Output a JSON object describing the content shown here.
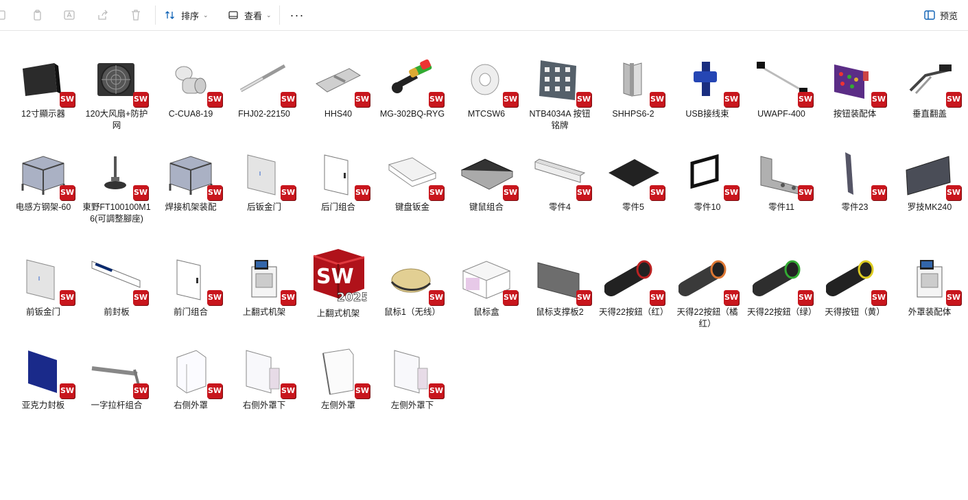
{
  "toolbar": {
    "sort_label": "排序",
    "view_label": "查看",
    "more_label": "···",
    "preview_label": "预览"
  },
  "badge_text": "SW",
  "big_badge": {
    "line1": "SW",
    "line2": "2025"
  },
  "files": [
    {
      "label": "12寸顯示器",
      "icon": "monitor"
    },
    {
      "label": "120大风扇+防护网",
      "icon": "fan"
    },
    {
      "label": "C-CUA8-19",
      "icon": "coupling"
    },
    {
      "label": "FHJ02-22150",
      "icon": "gas-spring"
    },
    {
      "label": "HHS40",
      "icon": "hinge-flat"
    },
    {
      "label": "MG-302BQ-RYG",
      "icon": "tower-light"
    },
    {
      "label": "MTCSW6",
      "icon": "washer"
    },
    {
      "label": "NTB4034A 按钮铭牌",
      "icon": "nameplate"
    },
    {
      "label": "SHHPS6-2",
      "icon": "hinge"
    },
    {
      "label": "USB接线束",
      "icon": "usb"
    },
    {
      "label": "UWAPF-400",
      "icon": "handle-bar"
    },
    {
      "label": "按钮装配体",
      "icon": "button-panel"
    },
    {
      "label": "垂直翻盖",
      "icon": "flip-cover"
    },
    {
      "label": "电感方钢架-60",
      "icon": "frame"
    },
    {
      "label": "東野FT100100M16(可調整腳座)",
      "icon": "leveling-foot"
    },
    {
      "label": "焊接机架装配",
      "icon": "frame"
    },
    {
      "label": "后钣金门",
      "icon": "panel"
    },
    {
      "label": "后门组合",
      "icon": "panel-white"
    },
    {
      "label": "键盘钣金",
      "icon": "tray"
    },
    {
      "label": "键鼠组合",
      "icon": "keyboard"
    },
    {
      "label": "零件4",
      "icon": "bar"
    },
    {
      "label": "零件5",
      "icon": "plate-black"
    },
    {
      "label": "零件10",
      "icon": "square-frame"
    },
    {
      "label": "零件11",
      "icon": "bracket"
    },
    {
      "label": "零件23",
      "icon": "strip"
    },
    {
      "label": "罗技MK240",
      "icon": "keyboard-dark"
    },
    {
      "label": "前钣金门",
      "icon": "panel"
    },
    {
      "label": "前封板",
      "icon": "front-plate"
    },
    {
      "label": "前门组合",
      "icon": "panel-white"
    },
    {
      "label": "上翻式机架",
      "icon": "machine"
    },
    {
      "label": "上翻式机架",
      "icon": "solidworks-2025"
    },
    {
      "label": "鼠标1（无线）",
      "icon": "mouse"
    },
    {
      "label": "鼠标盒",
      "icon": "box"
    },
    {
      "label": "鼠标支撑板2",
      "icon": "plate-grey"
    },
    {
      "label": "天得22按鈕（红）",
      "icon": "knob-red"
    },
    {
      "label": "天得22按鈕（橘红）",
      "icon": "knob-orange"
    },
    {
      "label": "天得22按鈕（绿）",
      "icon": "knob-green"
    },
    {
      "label": "天得按钮（黄）",
      "icon": "knob-yellow"
    },
    {
      "label": "外罩装配体",
      "icon": "machine"
    },
    {
      "label": "亚克力封板",
      "icon": "acrylic"
    },
    {
      "label": "一字拉杆组合",
      "icon": "rod"
    },
    {
      "label": "右侧外罩",
      "icon": "cover"
    },
    {
      "label": "右侧外罩下",
      "icon": "cover-low"
    },
    {
      "label": "左侧外罩",
      "icon": "cover-left"
    },
    {
      "label": "左侧外罩下",
      "icon": "cover-low"
    }
  ],
  "colors": {
    "accent": "#0a5fb4",
    "sw_badge": "#c8161d",
    "divider": "#e5e5e5"
  }
}
